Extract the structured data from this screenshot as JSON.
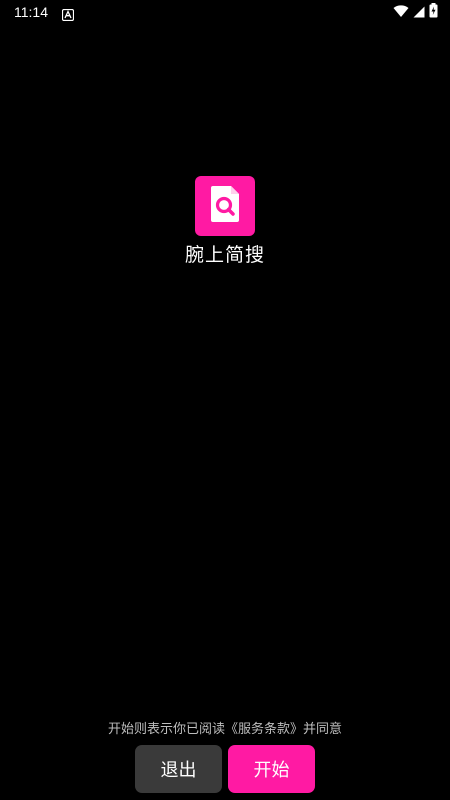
{
  "status_bar": {
    "time": "11:14",
    "notification_icon": "android-a-icon",
    "wifi_icon": "wifi-icon",
    "signal_icon": "cell-signal-icon",
    "battery_icon": "battery-charging-icon"
  },
  "app": {
    "name": "腕上简搜",
    "logo_icon": "document-search-icon",
    "accent_color": "#ff1aa3"
  },
  "footer": {
    "terms_text": "开始则表示你已阅读《服务条款》并同意",
    "exit_label": "退出",
    "start_label": "开始"
  }
}
